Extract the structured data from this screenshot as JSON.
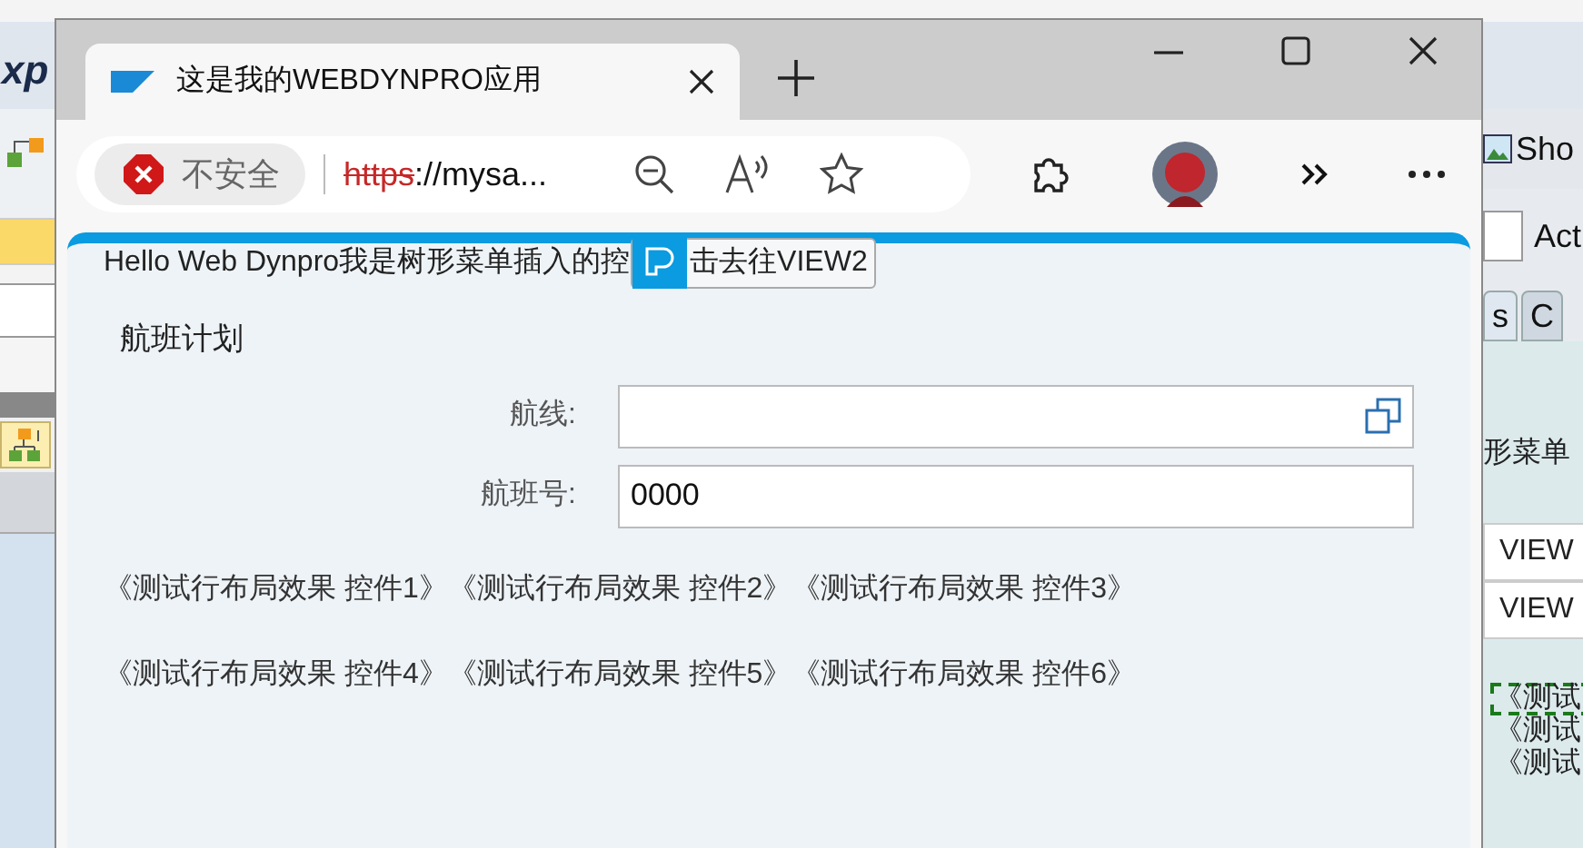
{
  "background_window": {
    "title": "xp",
    "toolbar_button": "Sho",
    "field_label": "Act",
    "tabs": [
      {
        "label": "s",
        "selected": true
      },
      {
        "label": "C",
        "selected": false
      }
    ],
    "text": "形菜单",
    "rows": [
      "VIEW",
      "VIEW"
    ],
    "items": [
      {
        "label": "《测试",
        "focused": true
      },
      {
        "label": "《测试",
        "focused": false
      },
      {
        "label": "《测试",
        "focused": false
      }
    ]
  },
  "browser": {
    "tabs": [
      {
        "title": "这是我的WEBDYNPRO应用",
        "selected": true
      }
    ],
    "security": "不安全",
    "url_scheme": "https",
    "url_rest": "://mysa..."
  },
  "page": {
    "intro": "Hello Web Dynpro我是树形菜单插入的控",
    "button": "击去往VIEW2",
    "section_title": "航班计划",
    "fields": [
      {
        "label": "航线:",
        "value_help": true
      },
      {
        "label": "航班号:",
        "value": "0000",
        "value_help": false
      }
    ],
    "items": [
      "《测试行布局效果 控件1》",
      "《测试行布局效果 控件2》",
      "《测试行布局效果 控件3》",
      "《测试行布局效果 控件4》",
      "《测试行布局效果 控件5》",
      "《测试行布局效果 控件6》"
    ]
  }
}
